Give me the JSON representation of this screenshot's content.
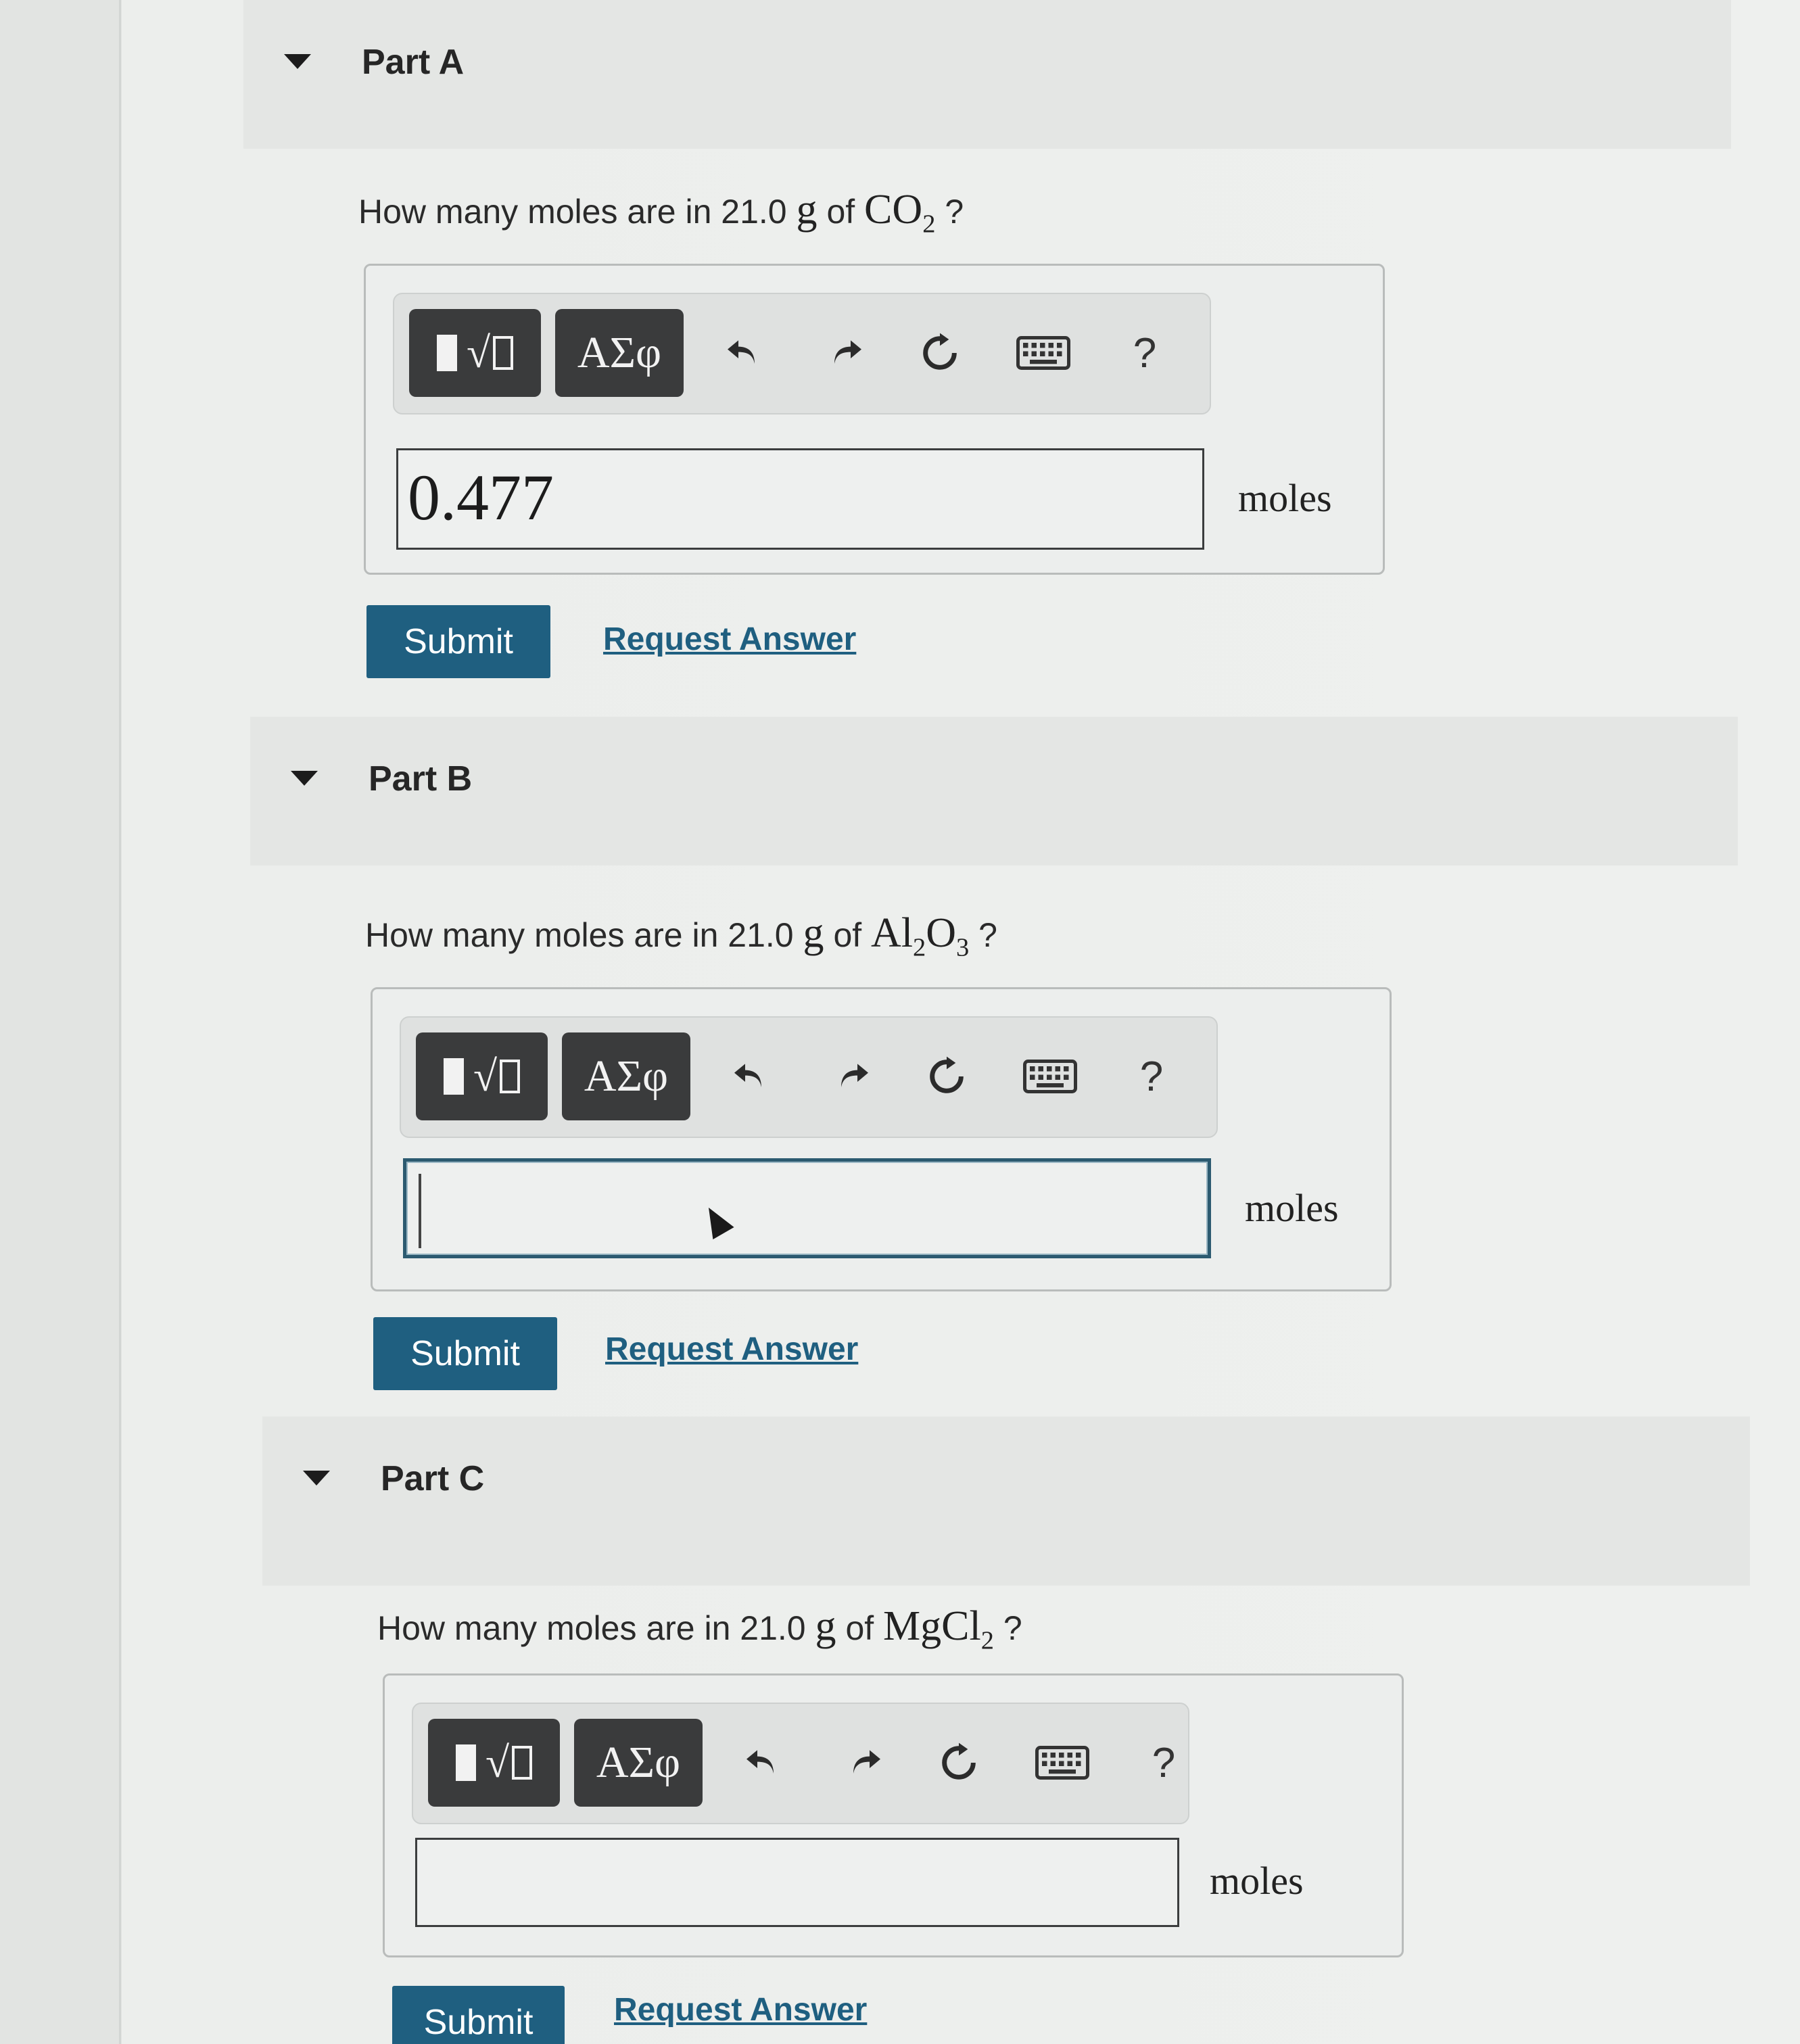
{
  "parts": [
    {
      "title": "Part A",
      "question_prefix": "How many moles are in 21.0",
      "question_unit": "g",
      "question_of": "of",
      "formula_main": "CO",
      "formula_sub": "2",
      "formula_main2": "",
      "formula_sub2": "",
      "question_suffix": "?",
      "answer_value": "0.477",
      "units": "moles",
      "submit_label": "Submit",
      "request_label": "Request Answer"
    },
    {
      "title": "Part B",
      "question_prefix": "How many moles are in 21.0",
      "question_unit": "g",
      "question_of": "of",
      "formula_main": "Al",
      "formula_sub": "2",
      "formula_main2": "O",
      "formula_sub2": "3",
      "question_suffix": "?",
      "answer_value": "",
      "units": "moles",
      "submit_label": "Submit",
      "request_label": "Request Answer"
    },
    {
      "title": "Part C",
      "question_prefix": "How many moles are in 21.0",
      "question_unit": "g",
      "question_of": "of",
      "formula_main": "MgCl",
      "formula_sub": "2",
      "formula_main2": "",
      "formula_sub2": "",
      "question_suffix": "?",
      "answer_value": "",
      "units": "moles",
      "submit_label": "Submit",
      "request_label": "Request Answer"
    }
  ],
  "toolbar": {
    "templates_label": "√",
    "greek_label": "ΑΣφ",
    "help_label": "?",
    "icons": [
      "templates-icon",
      "greek-symbols-icon",
      "undo-icon",
      "redo-icon",
      "reset-icon",
      "keyboard-icon",
      "help-icon"
    ]
  },
  "colors": {
    "primary": "#1f5f80",
    "toolbar_button": "#3a3b3c",
    "active_border": "#2c5a70"
  }
}
